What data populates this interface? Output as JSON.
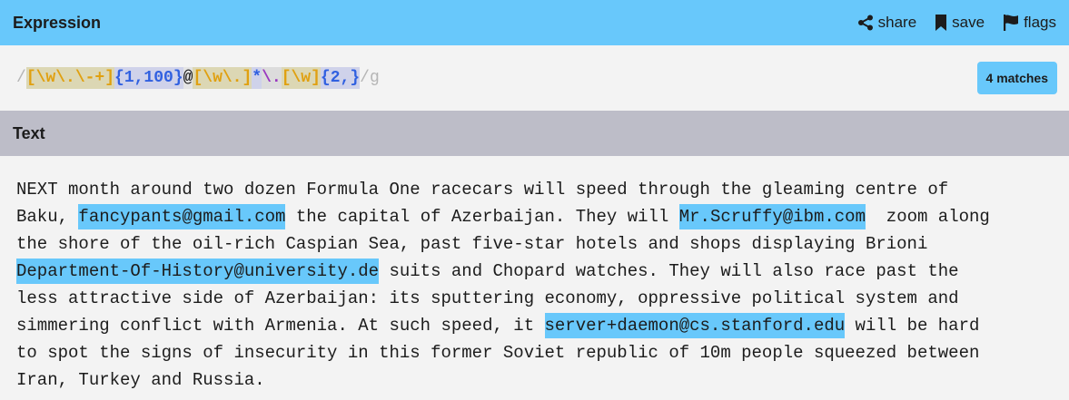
{
  "header": {
    "title": "Expression",
    "share_label": "share",
    "save_label": "save",
    "flags_label": "flags"
  },
  "expression": {
    "open_slash": "/",
    "tokens": [
      {
        "text": "[\\w\\.\\-+]",
        "kind": "set"
      },
      {
        "text": "{1,100}",
        "kind": "quant"
      },
      {
        "text": "@",
        "kind": "lit"
      },
      {
        "text": "[\\w\\.]",
        "kind": "set"
      },
      {
        "text": "*",
        "kind": "star"
      },
      {
        "text": "\\.",
        "kind": "dot"
      },
      {
        "text": "[\\w]",
        "kind": "set"
      },
      {
        "text": "{2,}",
        "kind": "quant"
      }
    ],
    "close_slash_flags": "/g",
    "match_count_label": "4 matches"
  },
  "text_panel": {
    "title": "Text",
    "lines": [
      [
        {
          "t": "NEXT month around two dozen Formula One racecars will speed through the gleaming centre of"
        }
      ],
      [
        {
          "t": "Baku, "
        },
        {
          "t": "fancypants@gmail.com",
          "m": true
        },
        {
          "t": " the capital of Azerbaijan. They will "
        },
        {
          "t": "Mr.Scruffy@ibm.com",
          "m": true
        },
        {
          "t": "  zoom along"
        }
      ],
      [
        {
          "t": "the shore of the oil-rich Caspian Sea, past five-star hotels and shops displaying Brioni"
        }
      ],
      [
        {
          "t": "Department-Of-History@university.de",
          "m": true
        },
        {
          "t": " suits and Chopard watches. They will also race past the"
        }
      ],
      [
        {
          "t": "less attractive side of Azerbaijan: its sputtering economy, oppressive political system and"
        }
      ],
      [
        {
          "t": "simmering conflict with Armenia. At such speed, it "
        },
        {
          "t": "server+daemon@cs.stanford.edu",
          "m": true
        },
        {
          "t": " will be hard"
        }
      ],
      [
        {
          "t": "to spot the signs of insecurity in this former Soviet republic of 10m people squeezed between"
        }
      ],
      [
        {
          "t": "Iran, Turkey and Russia."
        }
      ]
    ]
  },
  "colors": {
    "accent": "#68c8fb",
    "text_header_bg": "#bdbdc8",
    "background": "#f3f3f3"
  }
}
